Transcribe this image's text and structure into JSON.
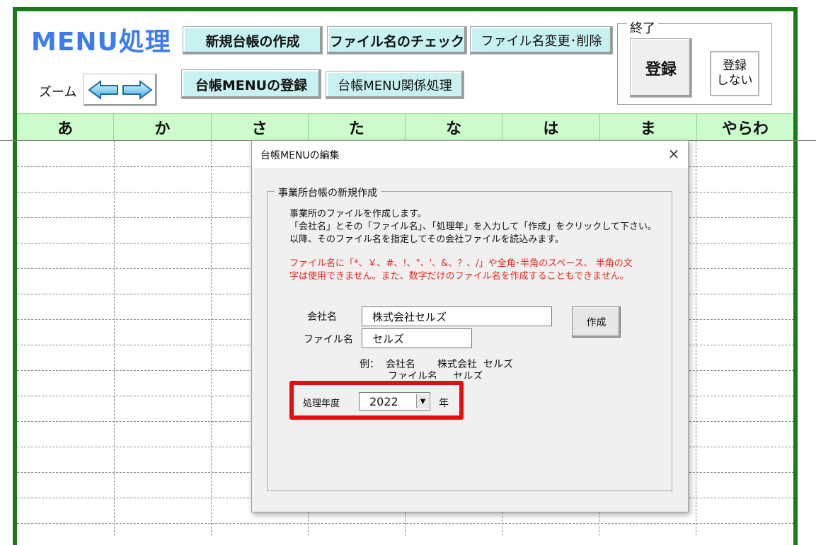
{
  "sheet": {
    "title": "MENU処理",
    "buttons": {
      "new_ledger": "新規台帳の作成",
      "file_check": "ファイル名のチェック",
      "file_rename": "ファイル名変更･削除",
      "ledger_menu_register": "台帳MENUの登録",
      "ledger_menu_related": "台帳MENU関係処理"
    },
    "zoom_label": "ズーム",
    "end_group": {
      "label": "終了",
      "register": "登録",
      "no_register_line1": "登録",
      "no_register_line2": "しない"
    },
    "kana_headers": [
      "あ",
      "か",
      "さ",
      "た",
      "な",
      "は",
      "ま",
      "やらわ"
    ]
  },
  "dialog": {
    "title": "台帳MENUの編集",
    "close": "×",
    "group_label": "事業所台帳の新規作成",
    "description": [
      "事業所のファイルを作成します。",
      "「会社名」とその「ファイル名」、「処理年」を入力して「作成」をクリックして下さい。",
      "以降、そのファイル名を指定してその会社ファイルを読込みます。"
    ],
    "warning": [
      "ファイル名に「*、￥、#、!、\"、'、&、？、/」や全角･半角のスペース、 半角の文",
      "字は使用できません。また、数字だけのファイル名を作成することもできません。"
    ],
    "company_label": "会社名",
    "company_value": "株式会社セルズ",
    "file_label": "ファイル名",
    "file_value": "セルズ",
    "create_button": "作成",
    "example": "例：  会社名       株式会社  セルズ\n         ファイル名     セルズ",
    "year_label": "処理年度",
    "year_value": "2022",
    "year_suffix": "年"
  },
  "colors": {
    "frame": "#1a7a1a",
    "title": "#3d7cf0",
    "cyan_button": "#c8f2f2",
    "kana_header": "#ccfccc",
    "warning": "#e0281e",
    "highlight": "#e01010"
  }
}
